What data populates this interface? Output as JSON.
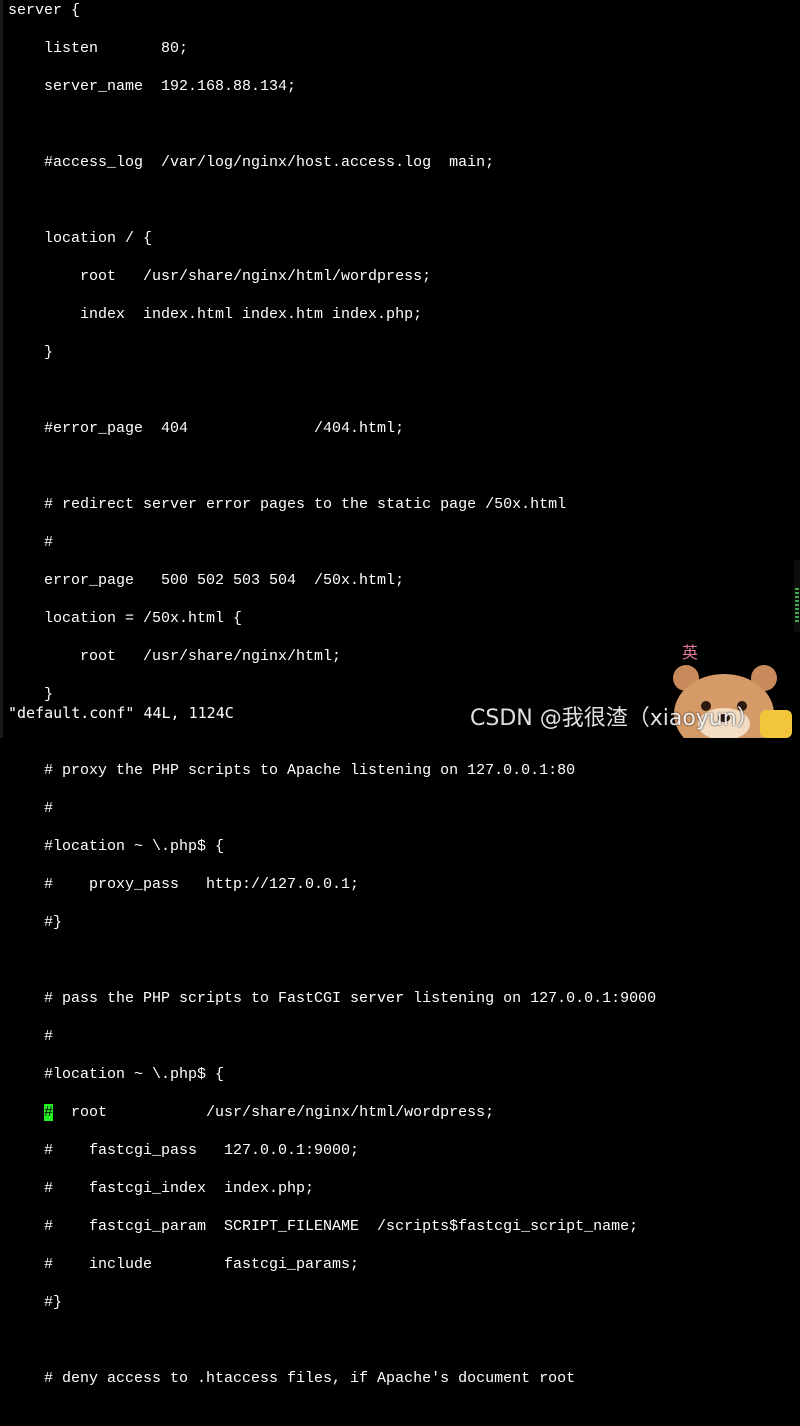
{
  "editor": {
    "lines": [
      "server {",
      "    listen       80;",
      "    server_name  192.168.88.134;",
      "",
      "    #access_log  /var/log/nginx/host.access.log  main;",
      "",
      "    location / {",
      "        root   /usr/share/nginx/html/wordpress;",
      "        index  index.html index.htm index.php;",
      "    }",
      "",
      "    #error_page  404              /404.html;",
      "",
      "    # redirect server error pages to the static page /50x.html",
      "    #",
      "    error_page   500 502 503 504  /50x.html;",
      "    location = /50x.html {",
      "        root   /usr/share/nginx/html;",
      "    }",
      "",
      "    # proxy the PHP scripts to Apache listening on 127.0.0.1:80",
      "    #",
      "    #location ~ \\.php$ {",
      "    #    proxy_pass   http://127.0.0.1;",
      "    #}",
      "",
      "    # pass the PHP scripts to FastCGI server listening on 127.0.0.1:9000",
      "    #",
      "    #location ~ \\.php$ {",
      "      root           /usr/share/nginx/html/wordpress;",
      "    #    fastcgi_pass   127.0.0.1:9000;",
      "    #    fastcgi_index  index.php;",
      "    #    fastcgi_param  SCRIPT_FILENAME  /scripts$fastcgi_script_name;",
      "    #    include        fastcgi_params;",
      "    #}",
      "",
      "    # deny access to .htaccess files, if Apache's document root"
    ],
    "cursor_prefix": "    ",
    "cursor_char": "#",
    "status": "\"default.conf\" 44L, 1124C",
    "cursor_color": "#22ee22",
    "text_color": "#ffffff",
    "background_color": "#000000"
  },
  "watermark": {
    "text": "CSDN @我很渣（xiaoyun）",
    "mascot_text": "英"
  }
}
